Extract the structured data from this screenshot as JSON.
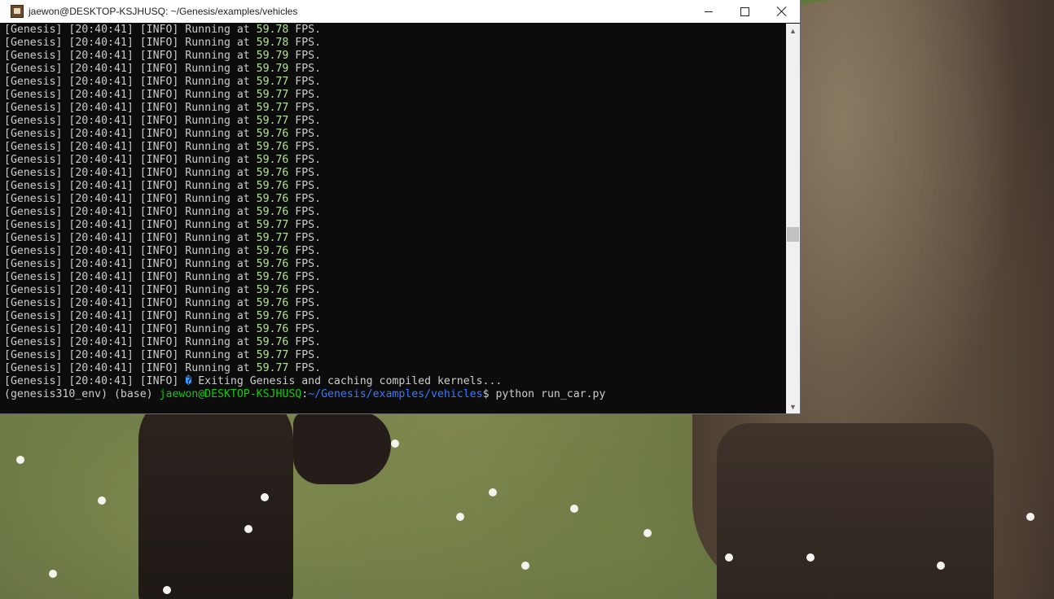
{
  "window": {
    "title": "jaewon@DESKTOP-KSJHUSQ: ~/Genesis/examples/vehicles",
    "minimize_glyph": "minimize-icon",
    "maximize_glyph": "maximize-icon",
    "close_glyph": "close-icon"
  },
  "terminal": {
    "log_lines": [
      {
        "prefix": "[Genesis] [20:40:41] [INFO] Running at ",
        "fps": "59.78",
        "suffix": " FPS."
      },
      {
        "prefix": "[Genesis] [20:40:41] [INFO] Running at ",
        "fps": "59.78",
        "suffix": " FPS."
      },
      {
        "prefix": "[Genesis] [20:40:41] [INFO] Running at ",
        "fps": "59.79",
        "suffix": " FPS."
      },
      {
        "prefix": "[Genesis] [20:40:41] [INFO] Running at ",
        "fps": "59.79",
        "suffix": " FPS."
      },
      {
        "prefix": "[Genesis] [20:40:41] [INFO] Running at ",
        "fps": "59.77",
        "suffix": " FPS."
      },
      {
        "prefix": "[Genesis] [20:40:41] [INFO] Running at ",
        "fps": "59.77",
        "suffix": " FPS."
      },
      {
        "prefix": "[Genesis] [20:40:41] [INFO] Running at ",
        "fps": "59.77",
        "suffix": " FPS."
      },
      {
        "prefix": "[Genesis] [20:40:41] [INFO] Running at ",
        "fps": "59.77",
        "suffix": " FPS."
      },
      {
        "prefix": "[Genesis] [20:40:41] [INFO] Running at ",
        "fps": "59.76",
        "suffix": " FPS."
      },
      {
        "prefix": "[Genesis] [20:40:41] [INFO] Running at ",
        "fps": "59.76",
        "suffix": " FPS."
      },
      {
        "prefix": "[Genesis] [20:40:41] [INFO] Running at ",
        "fps": "59.76",
        "suffix": " FPS."
      },
      {
        "prefix": "[Genesis] [20:40:41] [INFO] Running at ",
        "fps": "59.76",
        "suffix": " FPS."
      },
      {
        "prefix": "[Genesis] [20:40:41] [INFO] Running at ",
        "fps": "59.76",
        "suffix": " FPS."
      },
      {
        "prefix": "[Genesis] [20:40:41] [INFO] Running at ",
        "fps": "59.76",
        "suffix": " FPS."
      },
      {
        "prefix": "[Genesis] [20:40:41] [INFO] Running at ",
        "fps": "59.76",
        "suffix": " FPS."
      },
      {
        "prefix": "[Genesis] [20:40:41] [INFO] Running at ",
        "fps": "59.77",
        "suffix": " FPS."
      },
      {
        "prefix": "[Genesis] [20:40:41] [INFO] Running at ",
        "fps": "59.77",
        "suffix": " FPS."
      },
      {
        "prefix": "[Genesis] [20:40:41] [INFO] Running at ",
        "fps": "59.76",
        "suffix": " FPS."
      },
      {
        "prefix": "[Genesis] [20:40:41] [INFO] Running at ",
        "fps": "59.76",
        "suffix": " FPS."
      },
      {
        "prefix": "[Genesis] [20:40:41] [INFO] Running at ",
        "fps": "59.76",
        "suffix": " FPS."
      },
      {
        "prefix": "[Genesis] [20:40:41] [INFO] Running at ",
        "fps": "59.76",
        "suffix": " FPS."
      },
      {
        "prefix": "[Genesis] [20:40:41] [INFO] Running at ",
        "fps": "59.76",
        "suffix": " FPS."
      },
      {
        "prefix": "[Genesis] [20:40:41] [INFO] Running at ",
        "fps": "59.76",
        "suffix": " FPS."
      },
      {
        "prefix": "[Genesis] [20:40:41] [INFO] Running at ",
        "fps": "59.76",
        "suffix": " FPS."
      },
      {
        "prefix": "[Genesis] [20:40:41] [INFO] Running at ",
        "fps": "59.76",
        "suffix": " FPS."
      },
      {
        "prefix": "[Genesis] [20:40:41] [INFO] Running at ",
        "fps": "59.77",
        "suffix": " FPS."
      },
      {
        "prefix": "[Genesis] [20:40:41] [INFO] Running at ",
        "fps": "59.77",
        "suffix": " FPS."
      }
    ],
    "exit_line": {
      "prefix": "[Genesis] [20:40:41] [INFO] ",
      "glyph": "�",
      "message": " Exiting Genesis and caching compiled kernels..."
    },
    "prompt": {
      "env": "(genesis310_env) (base) ",
      "user_host": "jaewon@DESKTOP-KSJHUSQ",
      "colon": ":",
      "path": "~/Genesis/examples/vehicles",
      "dollar": "$ ",
      "command": "python run_car.py"
    }
  },
  "scrollbar": {
    "up_arrow": "▲",
    "down_arrow": "▼"
  },
  "colors": {
    "terminal_bg": "#0c0c0c",
    "terminal_fg": "#cccccc",
    "fps_value": "#b5e29b",
    "prompt_user": "#16c60c",
    "prompt_path": "#3b78ff"
  }
}
